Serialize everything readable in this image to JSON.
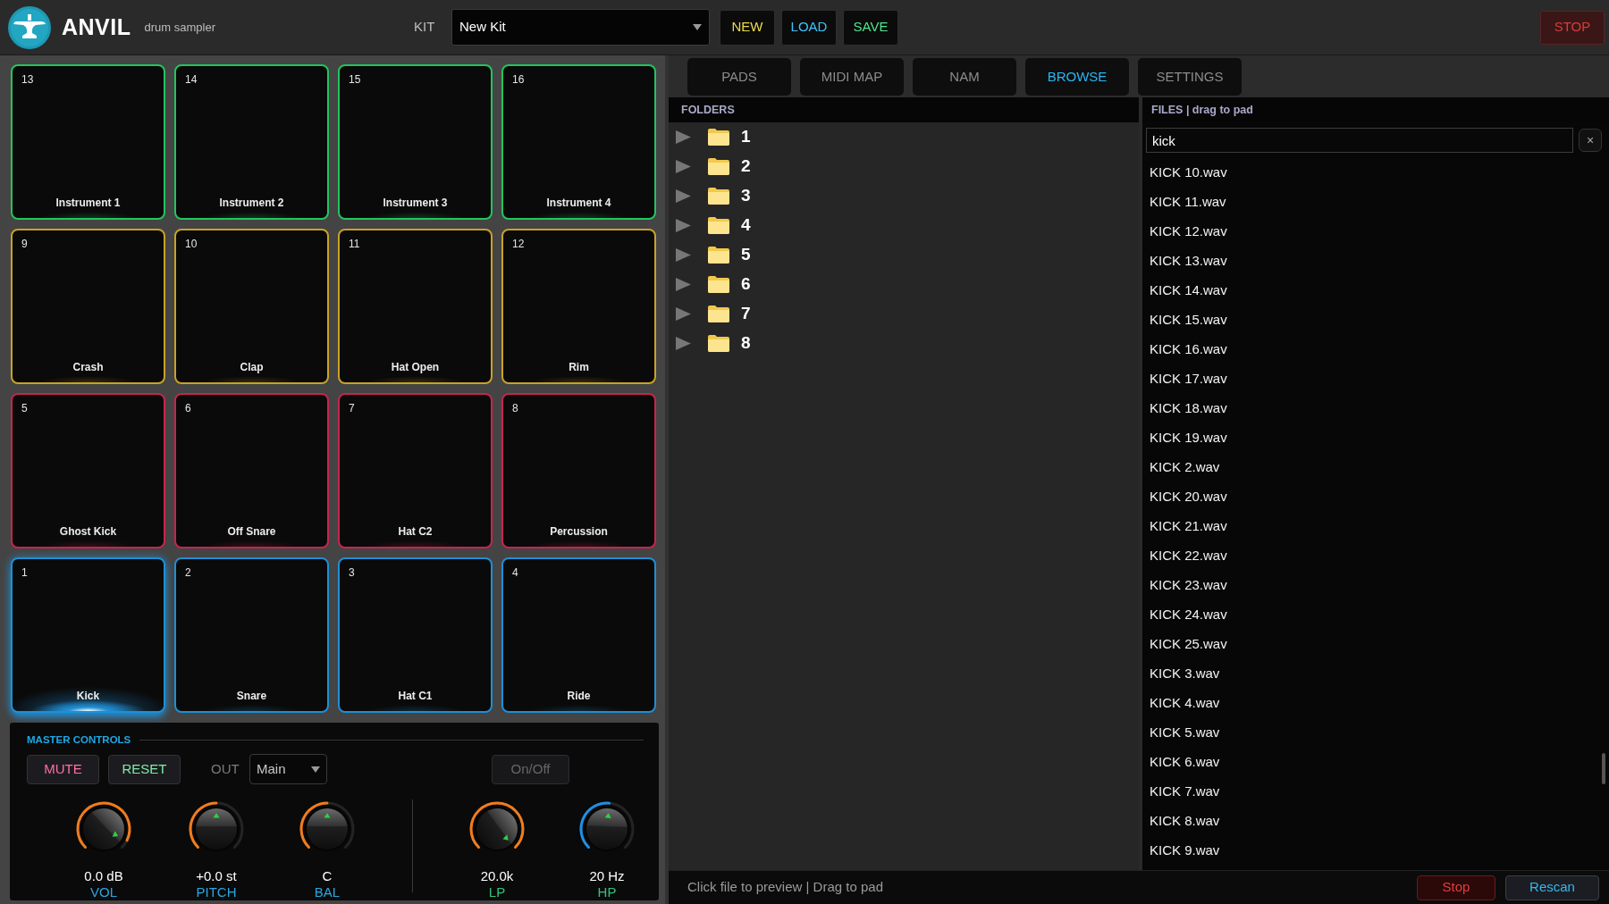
{
  "header": {
    "title": "ANVIL",
    "subtitle": "drum sampler",
    "kit": {
      "label": "KIT",
      "value": "New Kit"
    },
    "buttons": [
      {
        "label": "NEW",
        "kind": "new"
      },
      {
        "label": "LOAD",
        "kind": "load"
      },
      {
        "label": "SAVE",
        "kind": "save"
      }
    ],
    "stop_button": "STOP"
  },
  "pads": [
    {
      "number": "13",
      "name": "Instrument 1",
      "color": "#22c55e",
      "selected": false
    },
    {
      "number": "14",
      "name": "Instrument 2",
      "color": "#22c55e",
      "selected": false
    },
    {
      "number": "15",
      "name": "Instrument 3",
      "color": "#22c55e",
      "selected": false
    },
    {
      "number": "16",
      "name": "Instrument 4",
      "color": "#22c55e",
      "selected": false
    },
    {
      "number": "9",
      "name": "Crash",
      "color": "#c9a227",
      "selected": false
    },
    {
      "number": "10",
      "name": "Clap",
      "color": "#c9a227",
      "selected": false
    },
    {
      "number": "11",
      "name": "Hat Open",
      "color": "#c9a227",
      "selected": false
    },
    {
      "number": "12",
      "name": "Rim",
      "color": "#c9a227",
      "selected": false
    },
    {
      "number": "5",
      "name": "Ghost Kick",
      "color": "#c8244f",
      "selected": false
    },
    {
      "number": "6",
      "name": "Off Snare",
      "color": "#c8244f",
      "selected": false
    },
    {
      "number": "7",
      "name": "Hat C2",
      "color": "#c8244f",
      "selected": false
    },
    {
      "number": "8",
      "name": "Percussion",
      "color": "#c8244f",
      "selected": false
    },
    {
      "number": "1",
      "name": "Kick",
      "color": "#1f8fd6",
      "selected": true
    },
    {
      "number": "2",
      "name": "Snare",
      "color": "#1f8fd6",
      "selected": false
    },
    {
      "number": "3",
      "name": "Hat C1",
      "color": "#1f8fd6",
      "selected": false
    },
    {
      "number": "4",
      "name": "Ride",
      "color": "#1f8fd6",
      "selected": false
    }
  ],
  "master": {
    "title": "MASTER CONTROLS",
    "buttons": [
      {
        "label": "MUTE",
        "kind": "mute"
      },
      {
        "label": "RESET",
        "kind": "reset"
      }
    ],
    "output": {
      "label": "OUT",
      "value": "Main"
    },
    "filter_toggle": {
      "label": "On/Off",
      "on": false
    },
    "knobs": [
      {
        "value": "0.0 dB",
        "name": "VOL",
        "level": 0.93,
        "color": "#f07c1e"
      },
      {
        "value": "+0.0 st",
        "name": "PITCH",
        "level": 0.5,
        "color": "#f07c1e"
      },
      {
        "value": "C",
        "name": "BAL",
        "level": 0.5,
        "color": "#f07c1e"
      }
    ],
    "filter_knobs": [
      {
        "value": "20.0k",
        "name": "LP",
        "level": 1,
        "color": "#f07c1e"
      },
      {
        "value": "20 Hz",
        "name": "HP",
        "level": 0.52,
        "color": "#1e90e6"
      }
    ]
  },
  "tabs": [
    {
      "label": "PADS",
      "selected": false
    },
    {
      "label": "MIDI MAP",
      "selected": false
    },
    {
      "label": "NAM",
      "selected": false
    },
    {
      "label": "BROWSE",
      "selected": true
    },
    {
      "label": "SETTINGS",
      "selected": false
    }
  ],
  "folders": {
    "title": "FOLDERS",
    "items": [
      {
        "label": "1",
        "expanded": false
      },
      {
        "label": "2",
        "expanded": false
      },
      {
        "label": "3",
        "expanded": false
      },
      {
        "label": "4",
        "expanded": false
      },
      {
        "label": "5",
        "expanded": false
      },
      {
        "label": "6",
        "expanded": false
      },
      {
        "label": "7",
        "expanded": false
      },
      {
        "label": "8",
        "expanded": false
      }
    ]
  },
  "files": {
    "title": "FILES | drag to pad",
    "search": {
      "value": "kick"
    },
    "clear_button": "×",
    "items": [
      "KICK 10.wav",
      "KICK 11.wav",
      "KICK 12.wav",
      "KICK 13.wav",
      "KICK 14.wav",
      "KICK 15.wav",
      "KICK 16.wav",
      "KICK 17.wav",
      "KICK 18.wav",
      "KICK 19.wav",
      "KICK 2.wav",
      "KICK 20.wav",
      "KICK 21.wav",
      "KICK 22.wav",
      "KICK 23.wav",
      "KICK 24.wav",
      "KICK 25.wav",
      "KICK 3.wav",
      "KICK 4.wav",
      "KICK 5.wav",
      "KICK 6.wav",
      "KICK 7.wav",
      "KICK 8.wav",
      "KICK 9.wav"
    ]
  },
  "status_bar": {
    "hint": "Click file to preview | Drag to pad",
    "buttons": [
      {
        "label": "Stop",
        "kind": "stop"
      },
      {
        "label": "Rescan",
        "kind": "rescan"
      }
    ]
  }
}
